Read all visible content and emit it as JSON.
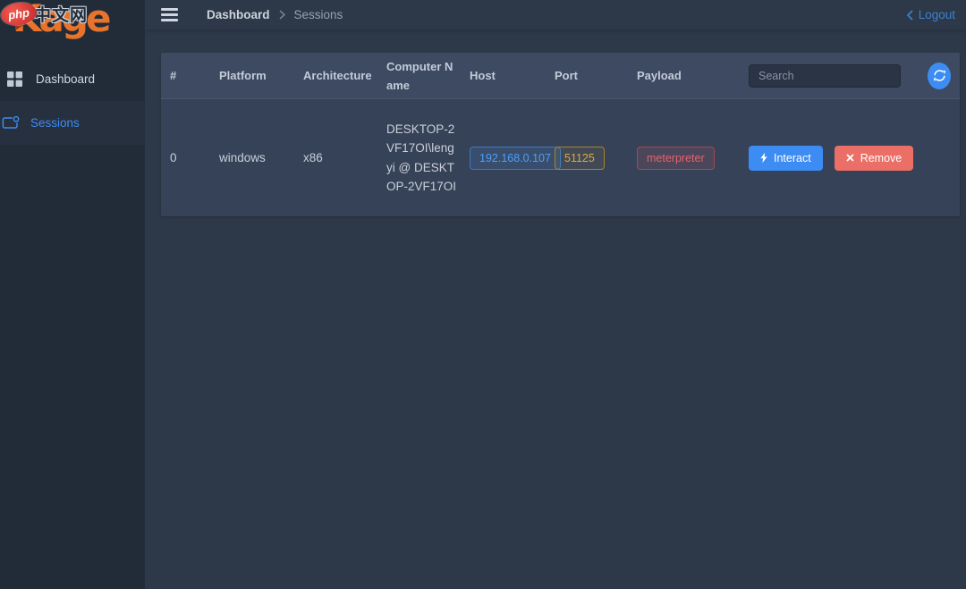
{
  "brand": {
    "logo_k": "K",
    "logo_rest": "age",
    "watermark_php": "php",
    "watermark_site": "中文网"
  },
  "sidebar": {
    "items": [
      {
        "label": "Dashboard"
      },
      {
        "label": "Sessions"
      }
    ]
  },
  "topbar": {
    "breadcrumb_root": "Dashboard",
    "breadcrumb_current": "Sessions",
    "logout": "Logout"
  },
  "sessions_table": {
    "headers": {
      "index": "#",
      "platform": "Platform",
      "architecture": "Architecture",
      "computer_name": "Computer Name",
      "host": "Host",
      "port": "Port",
      "payload": "Payload"
    },
    "search_placeholder": "Search",
    "rows": [
      {
        "index": "0",
        "platform": "windows",
        "architecture": "x86",
        "computer_name": "DESKTOP-2VF17OI\\lengyi @ DESKTOP-2VF17OI",
        "host": "192.168.0.107",
        "port": "51125",
        "payload": "meterpreter",
        "interact": "Interact",
        "remove": "Remove"
      }
    ]
  },
  "colors": {
    "accent_blue": "#3d8cf4",
    "danger_red": "#ec6f67",
    "port_yellow": "#e0a83e",
    "payload_red": "#e4636d",
    "logo_orange": "#e8732a",
    "sidebar_bg": "#222c39",
    "main_bg": "#2d3848",
    "table_header_bg": "#3d4a62",
    "table_row_bg": "#364257"
  }
}
